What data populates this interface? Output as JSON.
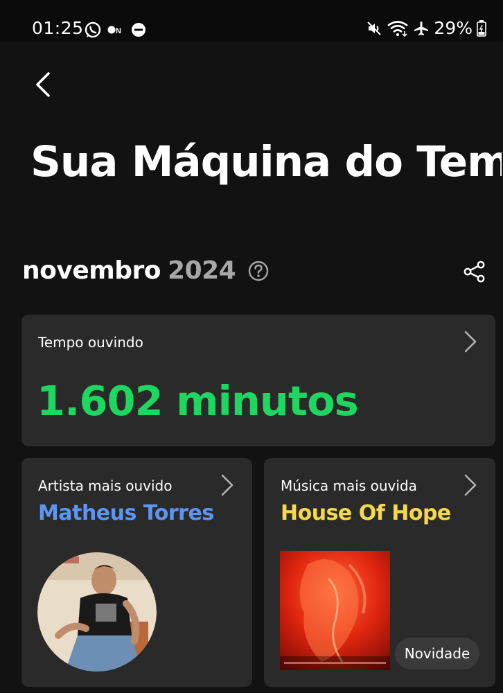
{
  "status_bar": {
    "time": "01:25",
    "battery_percent": "29%",
    "icons_left": [
      "whatsapp-icon",
      "on-icon",
      "do-not-disturb-icon"
    ],
    "icons_right": [
      "mute-icon",
      "wifi-icon",
      "airplane-icon",
      "battery-icon"
    ]
  },
  "header": {
    "title": "Sua Máquina do Tem..."
  },
  "period": {
    "month": "novembro",
    "year": "2024"
  },
  "listening_time": {
    "label": "Tempo ouvindo",
    "value": "1.602 minutos"
  },
  "top_artist": {
    "label": "Artista mais ouvido",
    "name": "Matheus Torres"
  },
  "top_song": {
    "label": "Música mais ouvida",
    "name": "House Of Hope",
    "badge": "Novidade"
  },
  "colors": {
    "background": "#121212",
    "card": "#2a2a2a",
    "minutes": "#1ed760",
    "artist": "#5e95f0",
    "song": "#f6d84a",
    "year": "#a7a7a7"
  }
}
